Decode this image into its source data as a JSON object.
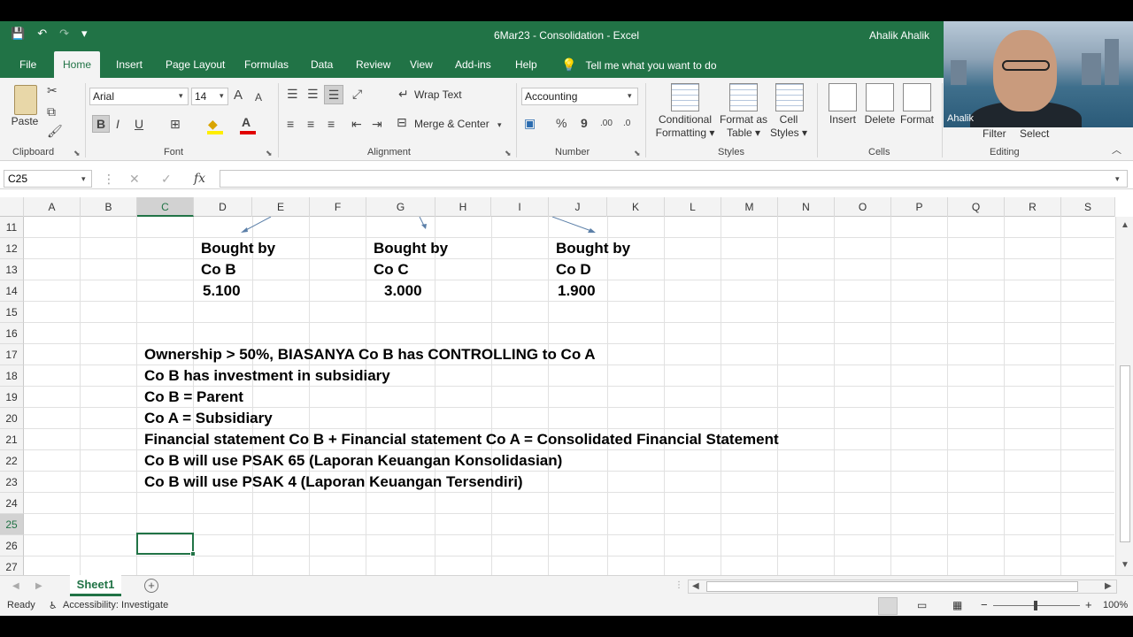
{
  "window": {
    "title": "6Mar23 - Consolidation  -  Excel",
    "user": "Ahalik Ahalik",
    "qat": {
      "save": "💾",
      "undo": "↶",
      "redo": "↷",
      "more": "▾"
    }
  },
  "menu": {
    "tabs": [
      "File",
      "Home",
      "Insert",
      "Page Layout",
      "Formulas",
      "Data",
      "Review",
      "View",
      "Add-ins",
      "Help"
    ],
    "active": "Home",
    "tell_me": "Tell me what you want to do"
  },
  "ribbon": {
    "clipboard": {
      "paste": "Paste",
      "label": "Clipboard"
    },
    "font": {
      "name": "Arial",
      "size": "14",
      "label": "Font",
      "bold": "B",
      "italic": "I",
      "underline": "U",
      "grow": "A",
      "shrink": "A"
    },
    "alignment": {
      "wrap": "Wrap Text",
      "merge": "Merge & Center",
      "label": "Alignment"
    },
    "number": {
      "format": "Accounting",
      "label": "Number",
      "percent": "%",
      "comma": "9",
      "inc": ".00",
      "dec": ".0"
    },
    "styles": {
      "conditional": "Conditional",
      "conditional2": "Formatting",
      "format_as": "Format as",
      "format_as2": "Table",
      "cell": "Cell",
      "cell2": "Styles",
      "label": "Styles"
    },
    "cells": {
      "insert": "Insert",
      "delete": "Delete",
      "format": "Format",
      "label": "Cells"
    },
    "editing": {
      "filter": "Filter",
      "select": "Select",
      "label": "Editing"
    }
  },
  "formula_bar": {
    "name_box": "C25",
    "fx": "fx",
    "value": ""
  },
  "columns": [
    "A",
    "B",
    "C",
    "D",
    "E",
    "F",
    "G",
    "H",
    "I",
    "J",
    "K",
    "L",
    "M",
    "N",
    "O",
    "P",
    "Q",
    "R",
    "S"
  ],
  "selected_column": "C",
  "rows": [
    "11",
    "12",
    "13",
    "14",
    "15",
    "16",
    "17",
    "18",
    "19",
    "20",
    "21",
    "22",
    "23",
    "24",
    "25",
    "26",
    "27"
  ],
  "selected_row": "25",
  "cells": {
    "d12": "Bought by",
    "g12": "Bought by",
    "j12": "Bought by",
    "d13": "Co B",
    "g13": "Co C",
    "j13": "Co D",
    "d14": "5.100",
    "g14": "3.000",
    "j14": "1.900",
    "c17": "Ownership > 50%, BIASANYA Co B has CONTROLLING to Co A",
    "c18": "Co B has investment in subsidiary",
    "c19": "Co B = Parent",
    "c20": "Co A = Subsidiary",
    "c21": "Financial statement Co B + Financial statement Co A = Consolidated Financial Statement",
    "c22": "Co B will use PSAK 65 (Laporan Keuangan Konsolidasian)",
    "c23": "Co B will use PSAK 4 (Laporan Keuangan Tersendiri)"
  },
  "sheets": {
    "active": "Sheet1",
    "add": "+"
  },
  "status": {
    "ready": "Ready",
    "accessibility": "Accessibility: Investigate",
    "zoom": "100%",
    "zoom_minus": "−",
    "zoom_plus": "+"
  },
  "webcam": {
    "name": "Ahalik"
  },
  "colors": {
    "excel_green": "#217346",
    "ribbon_bg": "#f3f3f3"
  }
}
